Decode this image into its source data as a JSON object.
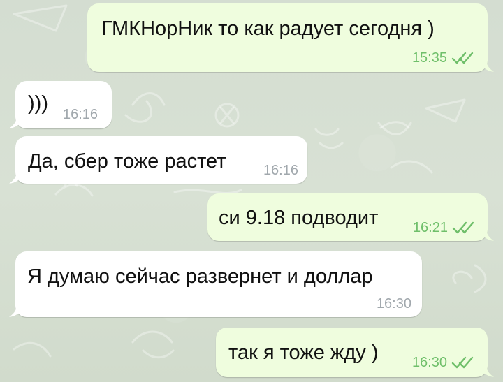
{
  "chat": {
    "messages": [
      {
        "direction": "out",
        "text": "ГМКНорНик то как радует сегодня )",
        "time": "15:35",
        "status_icon": "double-check-icon"
      },
      {
        "direction": "in",
        "text": ")))",
        "time": "16:16"
      },
      {
        "direction": "in",
        "text": "Да, сбер тоже растет",
        "time": "16:16"
      },
      {
        "direction": "out",
        "text": "си 9.18 подводит",
        "time": "16:21",
        "status_icon": "double-check-icon"
      },
      {
        "direction": "in",
        "text": "Я думаю сейчас развернет и доллар",
        "time": "16:30"
      },
      {
        "direction": "out",
        "text": "так я тоже жду )",
        "time": "16:30",
        "status_icon": "double-check-icon"
      }
    ]
  },
  "colors": {
    "background": "#d6dfd3",
    "incoming_bubble": "#ffffff",
    "outgoing_bubble": "#effdde",
    "incoming_time": "#a1a8ad",
    "outgoing_time_and_checks": "#6fbf6a"
  }
}
